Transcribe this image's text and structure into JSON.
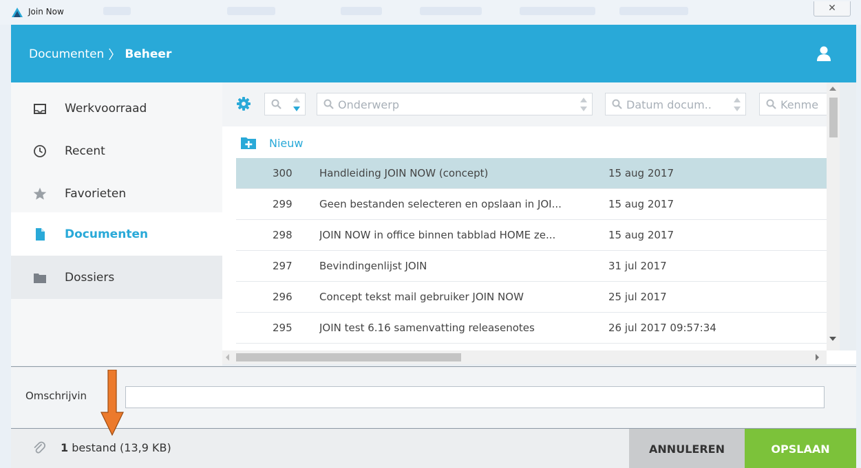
{
  "window": {
    "title": "Join Now",
    "close_glyph": "✕"
  },
  "header": {
    "breadcrumb": [
      {
        "label": "Documenten"
      },
      {
        "label": "Beheer"
      }
    ],
    "separator": "〉",
    "user_icon": "user-icon"
  },
  "sidebar": {
    "items": [
      {
        "label": "Werkvoorraad",
        "icon": "inbox-icon",
        "active": false
      },
      {
        "label": "Recent",
        "icon": "clock-icon",
        "active": false
      },
      {
        "label": "Favorieten",
        "icon": "star-icon",
        "active": false
      },
      {
        "label": "Documenten",
        "icon": "document-icon",
        "active": true
      },
      {
        "label": "Dossiers",
        "icon": "folder-icon",
        "active": false
      }
    ]
  },
  "filters": {
    "columns": [
      {
        "placeholder": ""
      },
      {
        "placeholder": "Onderwerp"
      },
      {
        "placeholder": "Datum docum.."
      },
      {
        "placeholder": "Kenme"
      }
    ]
  },
  "new_button": {
    "label": "Nieuw"
  },
  "documents": [
    {
      "number": "300",
      "subject": "Handleiding JOIN NOW (concept)",
      "date": "15 aug 2017",
      "selected": true
    },
    {
      "number": "299",
      "subject": "Geen bestanden selecteren en opslaan in JOI...",
      "date": "15 aug 2017",
      "selected": false
    },
    {
      "number": "298",
      "subject": "JOIN NOW in office binnen tabblad HOME ze...",
      "date": "15 aug 2017",
      "selected": false
    },
    {
      "number": "297",
      "subject": "Bevindingenlijst JOIN",
      "date": "31 jul 2017",
      "selected": false
    },
    {
      "number": "296",
      "subject": "Concept tekst mail gebruiker JOIN NOW",
      "date": "25 jul 2017",
      "selected": false
    },
    {
      "number": "295",
      "subject": "JOIN test 6.16 samenvatting releasenotes",
      "date": "26 jul 2017 09:57:34",
      "selected": false
    }
  ],
  "description": {
    "label": "Omschrijvin",
    "value": ""
  },
  "footer": {
    "attachment_count": "1",
    "attachment_text": " bestand (13,9 KB)",
    "cancel_label": "ANNULEREN",
    "save_label": "OPSLAAN"
  },
  "colors": {
    "accent": "#29a9d8",
    "selected_row": "#c5dde3",
    "save": "#7cc23a",
    "cancel": "#c9cbcd",
    "arrow": "#ec7a2c"
  }
}
